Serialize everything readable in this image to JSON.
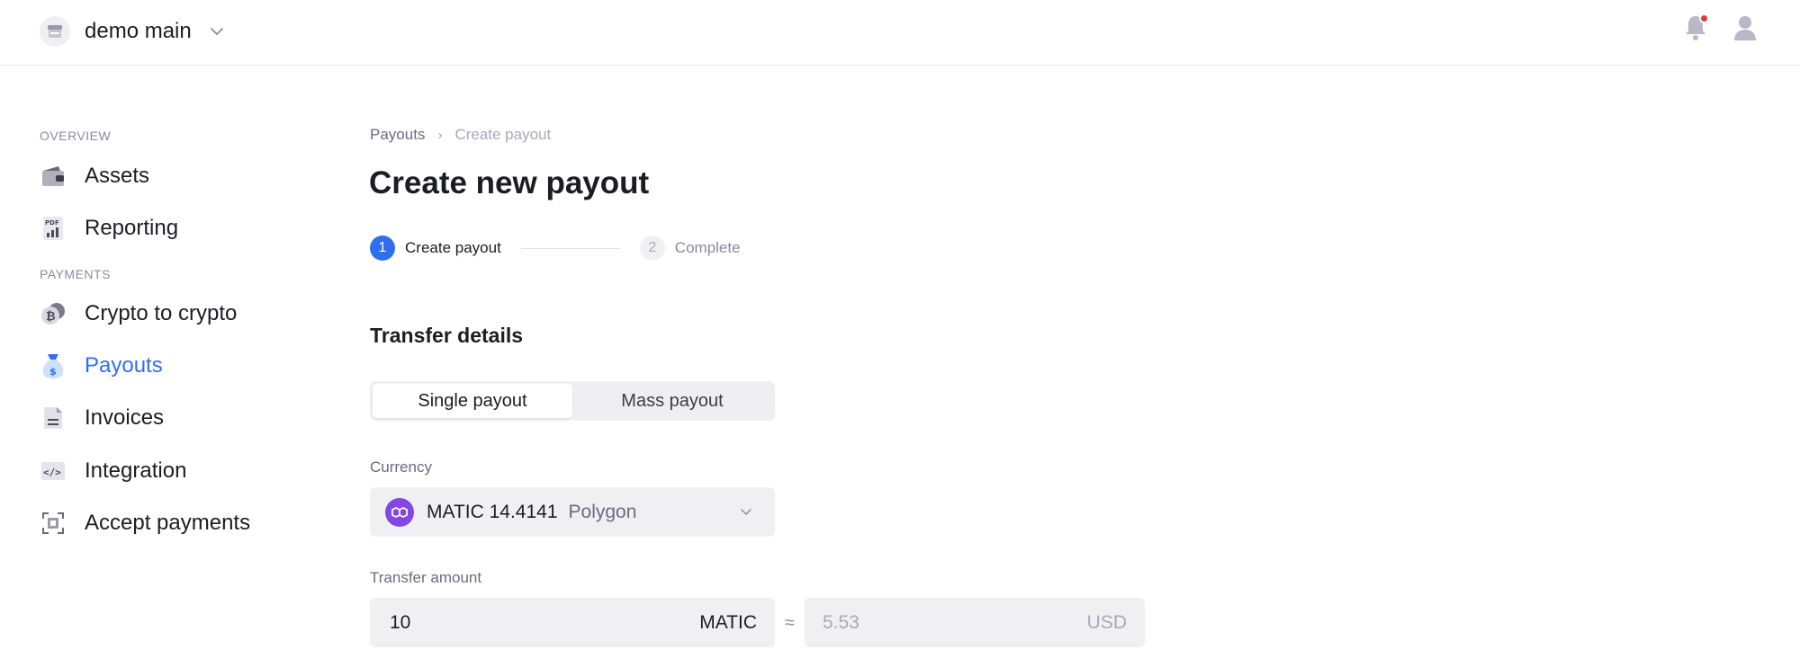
{
  "header": {
    "workspace_name": "demo main",
    "icons": [
      "store-icon",
      "chevron-down-icon",
      "bell-icon",
      "user-icon"
    ],
    "notification_color": "#e53935"
  },
  "sidebar": {
    "sections": [
      {
        "title": "OVERVIEW",
        "items": [
          {
            "label": "Assets",
            "icon": "wallet-icon"
          },
          {
            "label": "Reporting",
            "icon": "pdf-report-icon"
          }
        ]
      },
      {
        "title": "PAYMENTS",
        "items": [
          {
            "label": "Crypto to crypto",
            "icon": "coins-icon"
          },
          {
            "label": "Payouts",
            "icon": "money-bag-icon",
            "active": true
          },
          {
            "label": "Invoices",
            "icon": "document-icon"
          },
          {
            "label": "Integration",
            "icon": "code-icon"
          },
          {
            "label": "Accept payments",
            "icon": "qr-code-icon"
          }
        ]
      }
    ],
    "active_color": "#2f6fed"
  },
  "main": {
    "breadcrumb": [
      "Payouts",
      "Create payout"
    ],
    "title": "Create new payout",
    "steps": [
      {
        "number": "1",
        "label": "Create payout",
        "active": true
      },
      {
        "number": "2",
        "label": "Complete",
        "active": false
      }
    ],
    "section_title": "Transfer details",
    "payout_type": {
      "options": [
        "Single payout",
        "Mass payout"
      ],
      "selected": "Single payout"
    },
    "currency": {
      "label": "Currency",
      "code": "MATIC",
      "balance": "14.4141",
      "display": "MATIC 14.4141",
      "network": "Polygon",
      "coin_color": "#8247e5"
    },
    "amount": {
      "label": "Transfer amount",
      "value": "10",
      "unit": "MATIC",
      "approx_symbol": "≈",
      "fiat_value": "5.53",
      "fiat_unit": "USD"
    }
  }
}
